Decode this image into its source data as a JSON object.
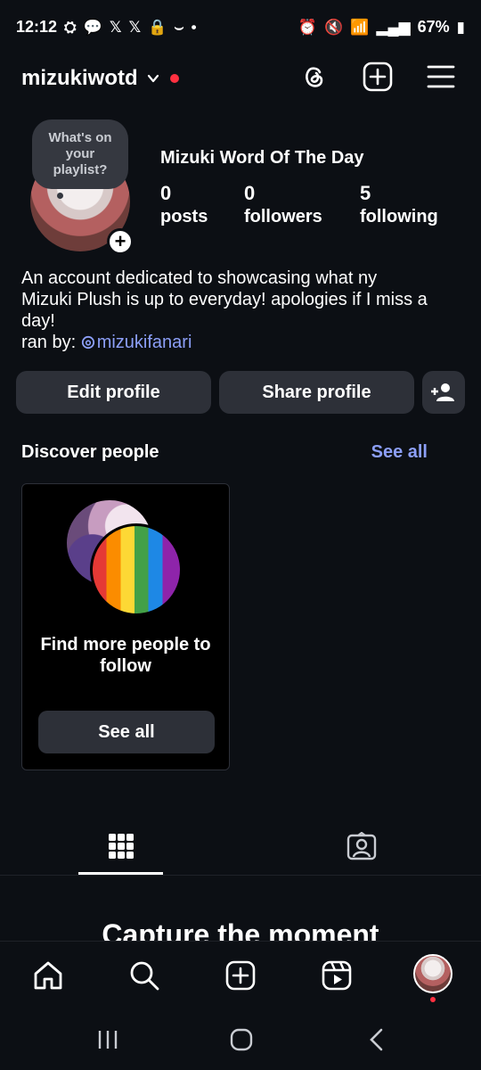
{
  "status_bar": {
    "time": "12:12",
    "left_glyphs": [
      "discord-icon",
      "chat-icon",
      "x-icon",
      "x-icon",
      "lock-icon",
      "wave-icon"
    ],
    "battery": "67%"
  },
  "profile": {
    "username": "mizukiwotd",
    "display_name": "Mizuki Word Of The Day",
    "note": "What's on your playlist?",
    "stats": [
      {
        "value": "0",
        "label": "posts"
      },
      {
        "value": "0",
        "label": "followers"
      },
      {
        "value": "5",
        "label": "following"
      }
    ],
    "bio_lines": [
      "An account dedicated to showcasing what ny",
      "Mizuki Plush is up to everyday! apologies if I miss a",
      "day!"
    ],
    "ran_by_prefix": "ran by: ",
    "mention": "mizukifanari"
  },
  "actions": {
    "edit_profile": "Edit profile",
    "share_profile": "Share profile"
  },
  "discover": {
    "title": "Discover people",
    "see_all_link": "See all",
    "card_text": "Find more people to follow",
    "card_button": "See all"
  },
  "empty_state": {
    "title": "Capture the moment"
  },
  "colors": {
    "background": "#0c0f14",
    "button": "#2d3038",
    "accent_link": "#8c9ff8",
    "notification_red": "#ff3040"
  }
}
